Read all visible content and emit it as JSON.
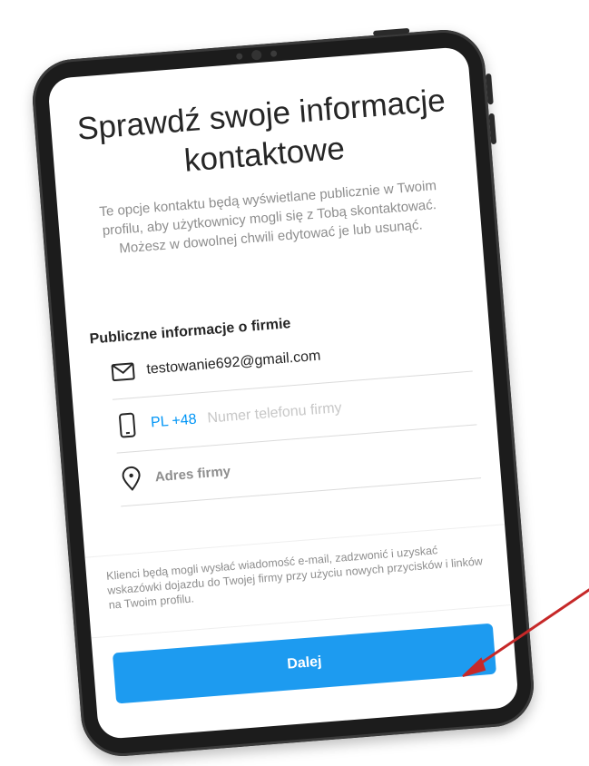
{
  "screen": {
    "title": "Sprawdź swoje informacje kontaktowe",
    "subtitle": "Te opcje kontaktu będą wyświetlane publicznie w Twoim profilu, aby użytkownicy mogli się z Tobą skontaktować. Możesz w dowolnej chwili edytować je lub usunąć.",
    "section_label": "Publiczne informacje o firmie",
    "email": {
      "icon": "mail-icon",
      "value": "testowanie692@gmail.com"
    },
    "phone": {
      "icon": "phone-icon",
      "country_code": "PL +48",
      "placeholder": "Numer telefonu firmy",
      "value": ""
    },
    "address": {
      "icon": "location-pin-icon",
      "label": "Adres firmy"
    },
    "footnote": "Klienci będą mogli wysłać wiadomość e-mail, zadzwonić i uzyskać wskazówki dojazdu do Twojej firmy przy użyciu nowych przycisków i linków na Twoim profilu.",
    "next_button_label": "Dalej"
  },
  "colors": {
    "accent": "#1d9bf0",
    "link": "#0095f6",
    "arrow": "#c62828",
    "tablet_frame": "#1c1c1c"
  }
}
